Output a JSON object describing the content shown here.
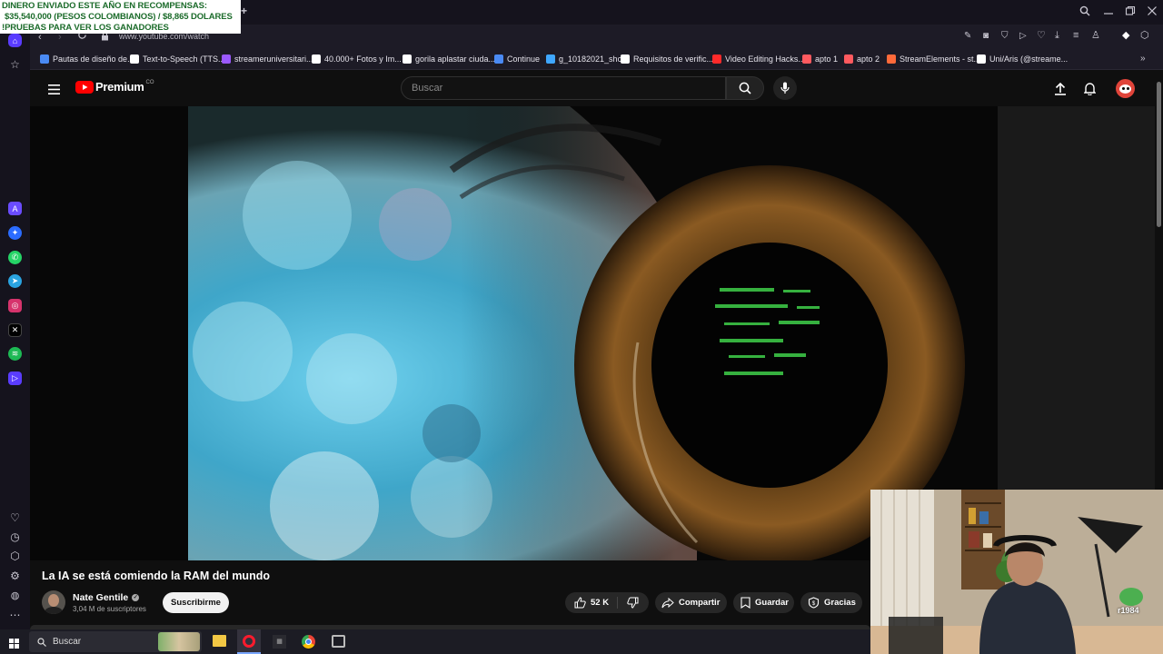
{
  "overlay": {
    "line1": "DINERO ENVIADO ESTE AÑO EN RECOMPENSAS:",
    "line2": "$35,540,000 (PESOS COLOMBIANOS) / $8,865 DOLARES",
    "line3": "!PRUEBAS PARA VER LOS GANADORES"
  },
  "browser": {
    "url": "www.youtube.com/watch",
    "bookmarks": [
      {
        "label": "Pautas de diseño de...",
        "color": "#4a8af4"
      },
      {
        "label": "Text-to-Speech (TTS...",
        "color": "#ffffff"
      },
      {
        "label": "streameruniversitari...",
        "color": "#9b59ff"
      },
      {
        "label": "40.000+ Fotos y Im...",
        "color": "#ffffff"
      },
      {
        "label": "gorila aplastar ciuda...",
        "color": "#ffffff"
      },
      {
        "label": "Continue",
        "color": "#4a8af4"
      },
      {
        "label": "g_10182021_shcc",
        "color": "#3fa7ff"
      },
      {
        "label": "Requisitos de verific...",
        "color": "#ffffff"
      },
      {
        "label": "Video Editing Hacks...",
        "color": "#ff2a2a"
      },
      {
        "label": "apto 1",
        "color": "#ff5a5f"
      },
      {
        "label": "apto 2",
        "color": "#ff5a5f"
      },
      {
        "label": "StreamElements - st...",
        "color": "#ff6a3a"
      },
      {
        "label": "Uni/Aris (@streame...",
        "color": "#ffffff"
      }
    ]
  },
  "youtube": {
    "logo_text": "Premium",
    "logo_sup": "CO",
    "search_placeholder": "Buscar",
    "video_title": "La IA se está comiendo la RAM del mundo",
    "channel_name": "Nate Gentile",
    "subscribers": "3,04 M de suscriptores",
    "subscribe_label": "Suscribirme",
    "likes": "52 K",
    "share_label": "Compartir",
    "save_label": "Guardar",
    "thanks_label": "Gracias",
    "accent": "#ff0000"
  },
  "taskbar": {
    "search_label": "Buscar"
  },
  "webcam": {
    "badge": "r1984"
  }
}
